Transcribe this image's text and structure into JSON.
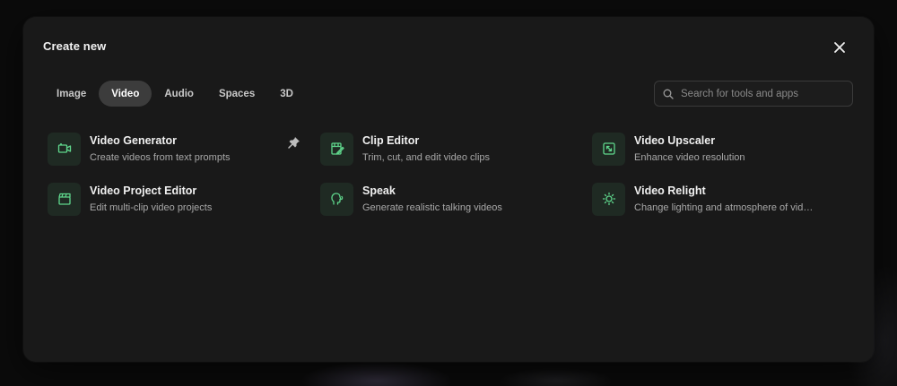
{
  "modal": {
    "title": "Create new"
  },
  "tabs": [
    {
      "label": "Image",
      "active": false
    },
    {
      "label": "Video",
      "active": true
    },
    {
      "label": "Audio",
      "active": false
    },
    {
      "label": "Spaces",
      "active": false
    },
    {
      "label": "3D",
      "active": false
    }
  ],
  "search": {
    "placeholder": "Search for tools and apps",
    "value": ""
  },
  "tools": [
    {
      "name": "Video Generator",
      "description": "Create videos from text prompts",
      "icon": "video-camera-icon",
      "pinned": true
    },
    {
      "name": "Clip Editor",
      "description": "Trim, cut, and edit video clips",
      "icon": "edit-clip-icon",
      "pinned": false
    },
    {
      "name": "Video Upscaler",
      "description": "Enhance video resolution",
      "icon": "upscale-icon",
      "pinned": false
    },
    {
      "name": "Video Project Editor",
      "description": "Edit multi-clip video projects",
      "icon": "clapperboard-icon",
      "pinned": false
    },
    {
      "name": "Speak",
      "description": "Generate realistic talking videos",
      "icon": "speaking-head-icon",
      "pinned": false
    },
    {
      "name": "Video Relight",
      "description": "Change lighting and atmosphere of vid…",
      "icon": "sun-icon",
      "pinned": false
    }
  ],
  "colors": {
    "accent": "#5fd68c",
    "modal_bg": "#191919",
    "icon_bg": "#1f2a23"
  }
}
